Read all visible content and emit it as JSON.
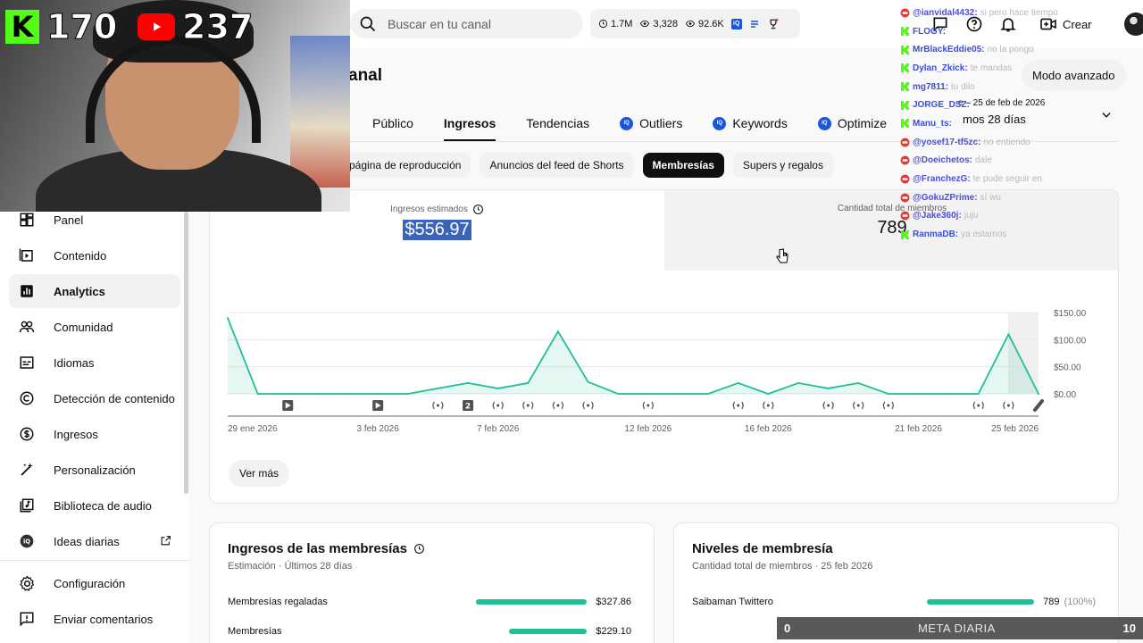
{
  "search": {
    "placeholder": "Buscar en tu canal"
  },
  "stats": {
    "subs": "1.7M",
    "views": "3,328",
    "views2": "92.6K"
  },
  "topbar": {
    "create_label": "Crear"
  },
  "channel": {
    "title_fragment": "anal"
  },
  "tabs": [
    {
      "label": "Público",
      "badge": false
    },
    {
      "label": "Ingresos",
      "badge": false,
      "active": true
    },
    {
      "label": "Tendencias",
      "badge": false
    },
    {
      "label": "Outliers",
      "badge": true
    },
    {
      "label": "Keywords",
      "badge": true
    },
    {
      "label": "Optimize",
      "badge": true
    }
  ],
  "mode_button": "Modo avanzado",
  "date": {
    "range": "e – 25 de feb de 2026",
    "label": "mos 28 días"
  },
  "chips": [
    {
      "label": "página de reproducción"
    },
    {
      "label": "Anuncios del feed de Shorts"
    },
    {
      "label": "Membresías",
      "active": true
    },
    {
      "label": "Supers y regalos"
    }
  ],
  "metrics": {
    "m1_label": "Ingresos estimados",
    "m1_value": "$556.97",
    "m2_label": "Cantidad total de miembros",
    "m2_value": "789"
  },
  "ver_mas": "Ver más",
  "sidebar": {
    "items": [
      {
        "label": "Panel",
        "icon": "dashboard-icon"
      },
      {
        "label": "Contenido",
        "icon": "content-icon"
      },
      {
        "label": "Analytics",
        "icon": "analytics-icon",
        "active": true
      },
      {
        "label": "Comunidad",
        "icon": "community-icon"
      },
      {
        "label": "Idiomas",
        "icon": "subtitles-icon"
      },
      {
        "label": "Detección de contenido",
        "icon": "copyright-icon"
      },
      {
        "label": "Ingresos",
        "icon": "dollar-icon"
      },
      {
        "label": "Personalización",
        "icon": "magic-wand-icon"
      },
      {
        "label": "Biblioteca de audio",
        "icon": "audio-library-icon"
      },
      {
        "label": "Ideas diarias",
        "icon": "ideas-icon"
      },
      {
        "label": "Configuración",
        "icon": "gear-icon"
      },
      {
        "label": "Enviar comentarios",
        "icon": "feedback-icon"
      }
    ]
  },
  "chart_data": {
    "type": "area",
    "x": [
      "29 ene",
      "30 ene",
      "31 ene",
      "1 feb",
      "2 feb",
      "3 feb",
      "4 feb",
      "5 feb",
      "6 feb",
      "7 feb",
      "8 feb",
      "9 feb",
      "10 feb",
      "11 feb",
      "12 feb",
      "13 feb",
      "14 feb",
      "15 feb",
      "16 feb",
      "17 feb",
      "18 feb",
      "19 feb",
      "20 feb",
      "21 feb",
      "22 feb",
      "23 feb",
      "24 feb",
      "25 feb"
    ],
    "values": [
      140,
      0,
      0,
      0,
      0,
      0,
      0,
      10,
      20,
      10,
      20,
      115,
      22,
      0,
      0,
      0,
      0,
      20,
      0,
      20,
      10,
      20,
      0,
      0,
      0,
      0,
      110,
      0
    ],
    "x_tick_labels": [
      "29 ene 2026",
      "3 feb 2026",
      "7 feb 2026",
      "12 feb 2026",
      "16 feb 2026",
      "21 feb 2026",
      "25 feb 2026"
    ],
    "y_tick_labels": [
      "$150.00",
      "$100.00",
      "$50.00",
      "$0.00"
    ],
    "ylim": [
      0,
      150
    ],
    "grid": true,
    "color": "#1fbf99"
  },
  "card_ingresos": {
    "title": "Ingresos de las membresías",
    "subtitle": "Estimación · Últimos 28 días",
    "rows": [
      {
        "name": "Membresías regaladas",
        "value": "$327.86",
        "frac": 1.0
      },
      {
        "name": "Membresías",
        "value": "$229.10",
        "frac": 0.7
      }
    ]
  },
  "card_niveles": {
    "title": "Niveles de membresía",
    "subtitle": "Cantidad total de miembros · 25 feb 2026",
    "rows": [
      {
        "name": "Saibaman Twittero",
        "value": "789",
        "pct": "(100%)",
        "frac": 1.0
      }
    ]
  },
  "webcam": {
    "kick_count": "170",
    "yt_count": "237"
  },
  "chat": [
    {
      "platform": "youtube",
      "user": "@ianvidal4432:",
      "msg": "si pero hace tiempo"
    },
    {
      "platform": "kick",
      "user": "FLOGY:",
      "msg": ""
    },
    {
      "platform": "kick",
      "user": "MrBlackEddie05:",
      "msg": "no la pongo"
    },
    {
      "platform": "kick",
      "user": "Dylan_Zkick:",
      "msg": "te mandas"
    },
    {
      "platform": "kick",
      "user": "mg7811:",
      "msg": "tu dilo"
    },
    {
      "platform": "kick",
      "user": "JORGE_DSZ:",
      "msg": ""
    },
    {
      "platform": "kick",
      "user": "Manu_ts:",
      "msg": ""
    },
    {
      "platform": "youtube",
      "user": "@yosef17-tf5zc:",
      "msg": "no entiendo"
    },
    {
      "platform": "youtube",
      "user": "@Doeichetos:",
      "msg": "dale"
    },
    {
      "platform": "youtube",
      "user": "@FranchezG:",
      "msg": "te pude seguir en"
    },
    {
      "platform": "youtube",
      "user": "@GokuZPrime:",
      "msg": "sí wu"
    },
    {
      "platform": "youtube",
      "user": "@Jake360j:",
      "msg": "juju"
    },
    {
      "platform": "kick",
      "user": "RanmaDB:",
      "msg": "ya estamos"
    }
  ],
  "meta_bar": {
    "left": "0",
    "title": "META DIARIA",
    "right": "10"
  },
  "colors": {
    "accent": "#1fbf99",
    "selection": "#3a64b8",
    "kick": "#53fc18",
    "youtube": "#ff0000"
  }
}
